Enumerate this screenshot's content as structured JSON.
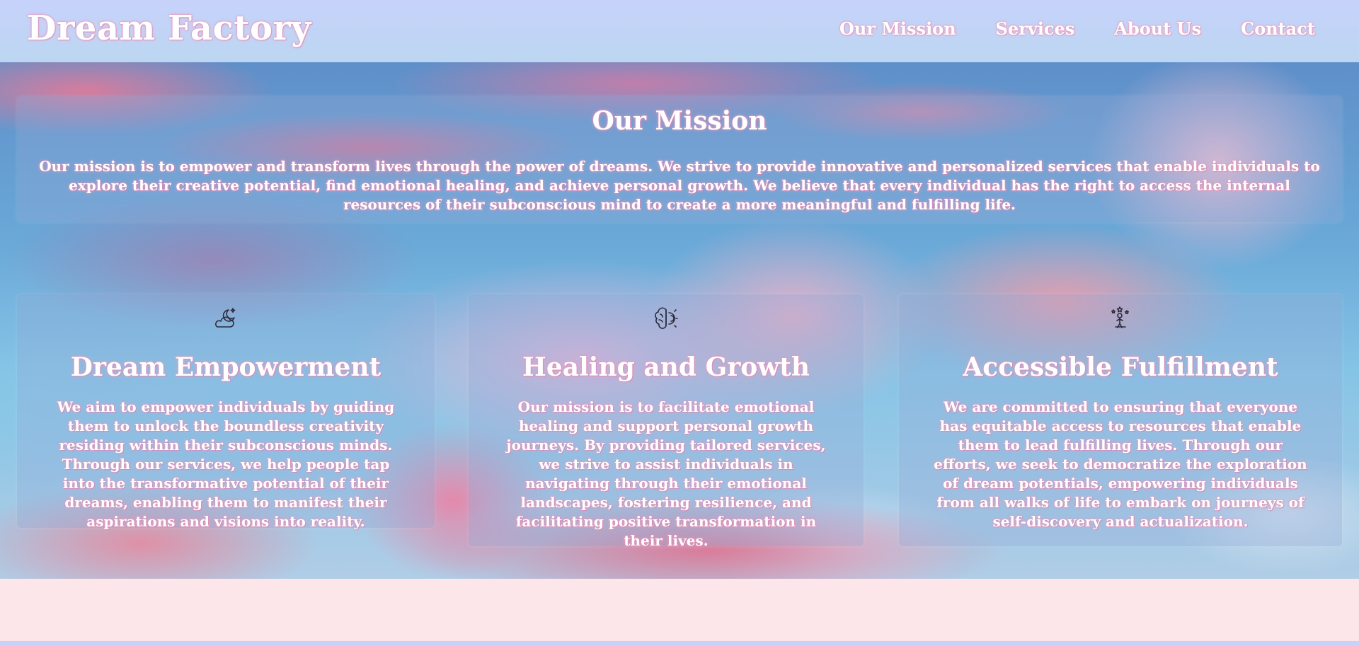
{
  "header": {
    "brand": "Dream Factory",
    "nav": [
      "Our Mission",
      "Services",
      "About Us",
      "Contact"
    ]
  },
  "mission": {
    "title": "Our Mission",
    "text": "Our mission is to empower and transform lives through the power of dreams. We strive to provide innovative and personalized services that enable individuals to explore their creative potential, find emotional healing, and achieve personal growth. We believe that every individual has the right to access the internal resources of their subconscious mind to create a more meaningful and fulfilling life."
  },
  "cards": [
    {
      "icon": "moon-cloud-icon",
      "title": "Dream Empowerment",
      "text": "We aim to empower individuals by guiding them to unlock the boundless creativity residing within their subconscious minds. Through our services, we help people tap into the transformative potential of their dreams, enabling them to manifest their aspirations and visions into reality."
    },
    {
      "icon": "brain-icon",
      "title": "Healing and Growth",
      "text": "Our mission is to facilitate emotional healing and support personal growth journeys. By providing tailored services, we strive to assist individuals in navigating through their emotional landscapes, fostering resilience, and facilitating positive transformation in their lives."
    },
    {
      "icon": "person-stars-icon",
      "title": "Accessible Fulfillment",
      "text": "We are committed to ensuring that everyone has equitable access to resources that enable them to lead fulfilling lives. Through our efforts, we seek to democratize the exploration of dream potentials, empowering individuals from all walks of life to embark on journeys of self-discovery and actualization."
    }
  ],
  "colors": {
    "header_bg": "#c7d2fb",
    "page_bg": "#fde6ea",
    "text_glow": "#e98cb4"
  }
}
